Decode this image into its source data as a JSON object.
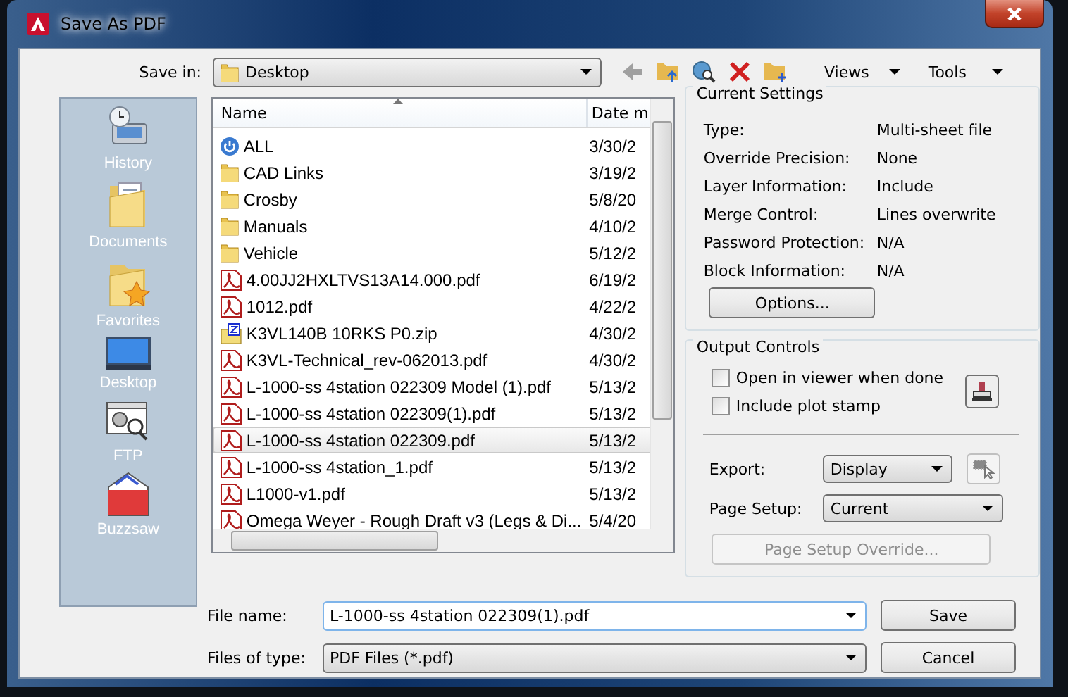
{
  "window": {
    "title": "Save As PDF"
  },
  "toolbar": {
    "save_in_label": "Save in:",
    "location": "Desktop",
    "views": "Views",
    "tools": "Tools"
  },
  "places": [
    {
      "label": "History",
      "kind": "history"
    },
    {
      "label": "Documents",
      "kind": "documents"
    },
    {
      "label": "Favorites",
      "kind": "favorites"
    },
    {
      "label": "Desktop",
      "kind": "desktop"
    },
    {
      "label": "FTP",
      "kind": "ftp"
    },
    {
      "label": "Buzzsaw",
      "kind": "buzzsaw"
    }
  ],
  "file_list": {
    "columns": [
      "Name",
      "Date m"
    ],
    "rows": [
      {
        "name": "ALL",
        "date": "3/30/2",
        "kind": "shortcut",
        "selected": false
      },
      {
        "name": "CAD Links",
        "date": "3/19/2",
        "kind": "folder",
        "selected": false
      },
      {
        "name": "Crosby",
        "date": "5/8/20",
        "kind": "folder",
        "selected": false
      },
      {
        "name": "Manuals",
        "date": "4/10/2",
        "kind": "folder",
        "selected": false
      },
      {
        "name": "Vehicle",
        "date": "5/12/2",
        "kind": "folder",
        "selected": false
      },
      {
        "name": "4.00JJ2HXLTVS13A14.000.pdf",
        "date": "6/19/2",
        "kind": "pdf",
        "selected": false
      },
      {
        "name": "1012.pdf",
        "date": "4/22/2",
        "kind": "pdf",
        "selected": false
      },
      {
        "name": "K3VL140B 10RKS P0.zip",
        "date": "4/30/2",
        "kind": "zip",
        "selected": false
      },
      {
        "name": "K3VL-Technical_rev-062013.pdf",
        "date": "4/30/2",
        "kind": "pdf",
        "selected": false
      },
      {
        "name": "L-1000-ss 4station 022309 Model (1).pdf",
        "date": "5/13/2",
        "kind": "pdf",
        "selected": false
      },
      {
        "name": "L-1000-ss 4station 022309(1).pdf",
        "date": "5/13/2",
        "kind": "pdf",
        "selected": false
      },
      {
        "name": "L-1000-ss 4station 022309.pdf",
        "date": "5/13/2",
        "kind": "pdf",
        "selected": true
      },
      {
        "name": "L-1000-ss 4station_1.pdf",
        "date": "5/13/2",
        "kind": "pdf",
        "selected": false
      },
      {
        "name": "L1000-v1.pdf",
        "date": "5/13/2",
        "kind": "pdf",
        "selected": false
      },
      {
        "name": "Omega Weyer - Rough Draft v3 (Legs & Di...",
        "date": "5/4/20",
        "kind": "pdf",
        "selected": false
      }
    ]
  },
  "current_settings": {
    "title": "Current Settings",
    "rows": [
      {
        "label": "Type:",
        "value": "Multi-sheet file"
      },
      {
        "label": "Override Precision:",
        "value": "None"
      },
      {
        "label": "Layer Information:",
        "value": "Include"
      },
      {
        "label": "Merge Control:",
        "value": "Lines overwrite"
      },
      {
        "label": "Password Protection:",
        "value": "N/A"
      },
      {
        "label": "Block Information:",
        "value": "N/A"
      }
    ],
    "options_button": "Options..."
  },
  "output_controls": {
    "title": "Output Controls",
    "checkboxes": [
      {
        "label": "Open in viewer when done",
        "checked": false
      },
      {
        "label": "Include plot stamp",
        "checked": false
      }
    ],
    "export_label": "Export:",
    "export_value": "Display",
    "page_setup_label": "Page Setup:",
    "page_setup_value": "Current",
    "override_button": {
      "label": "Page Setup Override...",
      "disabled": true
    }
  },
  "file_name": {
    "label": "File name:",
    "value": "L-1000-ss 4station 022309(1).pdf"
  },
  "file_type": {
    "label": "Files of type:",
    "value": "PDF Files (*.pdf)"
  },
  "buttons": {
    "save": "Save",
    "cancel": "Cancel"
  }
}
